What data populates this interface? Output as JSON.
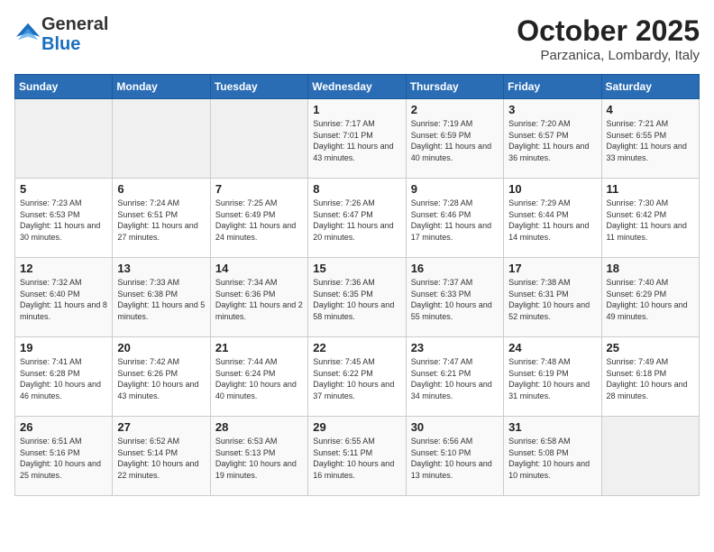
{
  "logo": {
    "general": "General",
    "blue": "Blue"
  },
  "title": "October 2025",
  "subtitle": "Parzanica, Lombardy, Italy",
  "weekdays": [
    "Sunday",
    "Monday",
    "Tuesday",
    "Wednesday",
    "Thursday",
    "Friday",
    "Saturday"
  ],
  "weeks": [
    [
      {
        "day": "",
        "sunrise": "",
        "sunset": "",
        "daylight": ""
      },
      {
        "day": "",
        "sunrise": "",
        "sunset": "",
        "daylight": ""
      },
      {
        "day": "",
        "sunrise": "",
        "sunset": "",
        "daylight": ""
      },
      {
        "day": "1",
        "sunrise": "Sunrise: 7:17 AM",
        "sunset": "Sunset: 7:01 PM",
        "daylight": "Daylight: 11 hours and 43 minutes."
      },
      {
        "day": "2",
        "sunrise": "Sunrise: 7:19 AM",
        "sunset": "Sunset: 6:59 PM",
        "daylight": "Daylight: 11 hours and 40 minutes."
      },
      {
        "day": "3",
        "sunrise": "Sunrise: 7:20 AM",
        "sunset": "Sunset: 6:57 PM",
        "daylight": "Daylight: 11 hours and 36 minutes."
      },
      {
        "day": "4",
        "sunrise": "Sunrise: 7:21 AM",
        "sunset": "Sunset: 6:55 PM",
        "daylight": "Daylight: 11 hours and 33 minutes."
      }
    ],
    [
      {
        "day": "5",
        "sunrise": "Sunrise: 7:23 AM",
        "sunset": "Sunset: 6:53 PM",
        "daylight": "Daylight: 11 hours and 30 minutes."
      },
      {
        "day": "6",
        "sunrise": "Sunrise: 7:24 AM",
        "sunset": "Sunset: 6:51 PM",
        "daylight": "Daylight: 11 hours and 27 minutes."
      },
      {
        "day": "7",
        "sunrise": "Sunrise: 7:25 AM",
        "sunset": "Sunset: 6:49 PM",
        "daylight": "Daylight: 11 hours and 24 minutes."
      },
      {
        "day": "8",
        "sunrise": "Sunrise: 7:26 AM",
        "sunset": "Sunset: 6:47 PM",
        "daylight": "Daylight: 11 hours and 20 minutes."
      },
      {
        "day": "9",
        "sunrise": "Sunrise: 7:28 AM",
        "sunset": "Sunset: 6:46 PM",
        "daylight": "Daylight: 11 hours and 17 minutes."
      },
      {
        "day": "10",
        "sunrise": "Sunrise: 7:29 AM",
        "sunset": "Sunset: 6:44 PM",
        "daylight": "Daylight: 11 hours and 14 minutes."
      },
      {
        "day": "11",
        "sunrise": "Sunrise: 7:30 AM",
        "sunset": "Sunset: 6:42 PM",
        "daylight": "Daylight: 11 hours and 11 minutes."
      }
    ],
    [
      {
        "day": "12",
        "sunrise": "Sunrise: 7:32 AM",
        "sunset": "Sunset: 6:40 PM",
        "daylight": "Daylight: 11 hours and 8 minutes."
      },
      {
        "day": "13",
        "sunrise": "Sunrise: 7:33 AM",
        "sunset": "Sunset: 6:38 PM",
        "daylight": "Daylight: 11 hours and 5 minutes."
      },
      {
        "day": "14",
        "sunrise": "Sunrise: 7:34 AM",
        "sunset": "Sunset: 6:36 PM",
        "daylight": "Daylight: 11 hours and 2 minutes."
      },
      {
        "day": "15",
        "sunrise": "Sunrise: 7:36 AM",
        "sunset": "Sunset: 6:35 PM",
        "daylight": "Daylight: 10 hours and 58 minutes."
      },
      {
        "day": "16",
        "sunrise": "Sunrise: 7:37 AM",
        "sunset": "Sunset: 6:33 PM",
        "daylight": "Daylight: 10 hours and 55 minutes."
      },
      {
        "day": "17",
        "sunrise": "Sunrise: 7:38 AM",
        "sunset": "Sunset: 6:31 PM",
        "daylight": "Daylight: 10 hours and 52 minutes."
      },
      {
        "day": "18",
        "sunrise": "Sunrise: 7:40 AM",
        "sunset": "Sunset: 6:29 PM",
        "daylight": "Daylight: 10 hours and 49 minutes."
      }
    ],
    [
      {
        "day": "19",
        "sunrise": "Sunrise: 7:41 AM",
        "sunset": "Sunset: 6:28 PM",
        "daylight": "Daylight: 10 hours and 46 minutes."
      },
      {
        "day": "20",
        "sunrise": "Sunrise: 7:42 AM",
        "sunset": "Sunset: 6:26 PM",
        "daylight": "Daylight: 10 hours and 43 minutes."
      },
      {
        "day": "21",
        "sunrise": "Sunrise: 7:44 AM",
        "sunset": "Sunset: 6:24 PM",
        "daylight": "Daylight: 10 hours and 40 minutes."
      },
      {
        "day": "22",
        "sunrise": "Sunrise: 7:45 AM",
        "sunset": "Sunset: 6:22 PM",
        "daylight": "Daylight: 10 hours and 37 minutes."
      },
      {
        "day": "23",
        "sunrise": "Sunrise: 7:47 AM",
        "sunset": "Sunset: 6:21 PM",
        "daylight": "Daylight: 10 hours and 34 minutes."
      },
      {
        "day": "24",
        "sunrise": "Sunrise: 7:48 AM",
        "sunset": "Sunset: 6:19 PM",
        "daylight": "Daylight: 10 hours and 31 minutes."
      },
      {
        "day": "25",
        "sunrise": "Sunrise: 7:49 AM",
        "sunset": "Sunset: 6:18 PM",
        "daylight": "Daylight: 10 hours and 28 minutes."
      }
    ],
    [
      {
        "day": "26",
        "sunrise": "Sunrise: 6:51 AM",
        "sunset": "Sunset: 5:16 PM",
        "daylight": "Daylight: 10 hours and 25 minutes."
      },
      {
        "day": "27",
        "sunrise": "Sunrise: 6:52 AM",
        "sunset": "Sunset: 5:14 PM",
        "daylight": "Daylight: 10 hours and 22 minutes."
      },
      {
        "day": "28",
        "sunrise": "Sunrise: 6:53 AM",
        "sunset": "Sunset: 5:13 PM",
        "daylight": "Daylight: 10 hours and 19 minutes."
      },
      {
        "day": "29",
        "sunrise": "Sunrise: 6:55 AM",
        "sunset": "Sunset: 5:11 PM",
        "daylight": "Daylight: 10 hours and 16 minutes."
      },
      {
        "day": "30",
        "sunrise": "Sunrise: 6:56 AM",
        "sunset": "Sunset: 5:10 PM",
        "daylight": "Daylight: 10 hours and 13 minutes."
      },
      {
        "day": "31",
        "sunrise": "Sunrise: 6:58 AM",
        "sunset": "Sunset: 5:08 PM",
        "daylight": "Daylight: 10 hours and 10 minutes."
      },
      {
        "day": "",
        "sunrise": "",
        "sunset": "",
        "daylight": ""
      }
    ]
  ]
}
